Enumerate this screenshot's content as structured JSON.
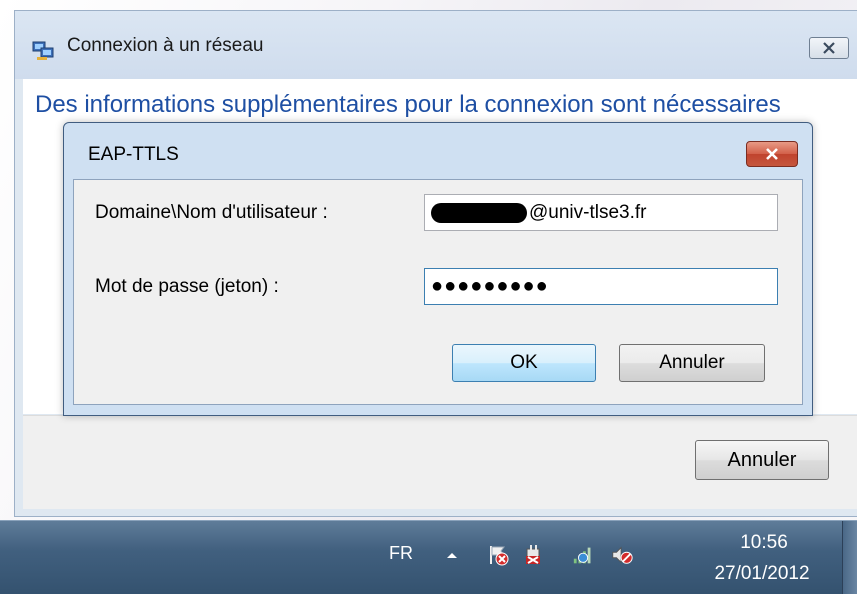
{
  "outer_window": {
    "title": "Connexion à un réseau",
    "heading_partial": "Des informations supplémentaires pour la connexion sont nécessaires",
    "cancel_label": "Annuler"
  },
  "dialog": {
    "title": "EAP-TTLS",
    "username_label": "Domaine\\Nom d'utilisateur :",
    "username_value": "@univ-tlse3.fr",
    "password_label": "Mot de passe (jeton) :",
    "password_value": "●●●●●●●●●",
    "ok_label": "OK",
    "cancel_label": "Annuler"
  },
  "taskbar": {
    "language": "FR",
    "tray_icons": [
      "show-hidden-icons-arrow",
      "action-center-flag-icon",
      "power-plug-icon",
      "network-icon",
      "volume-muted-icon"
    ],
    "time": "10:56",
    "date": "27/01/2012"
  }
}
